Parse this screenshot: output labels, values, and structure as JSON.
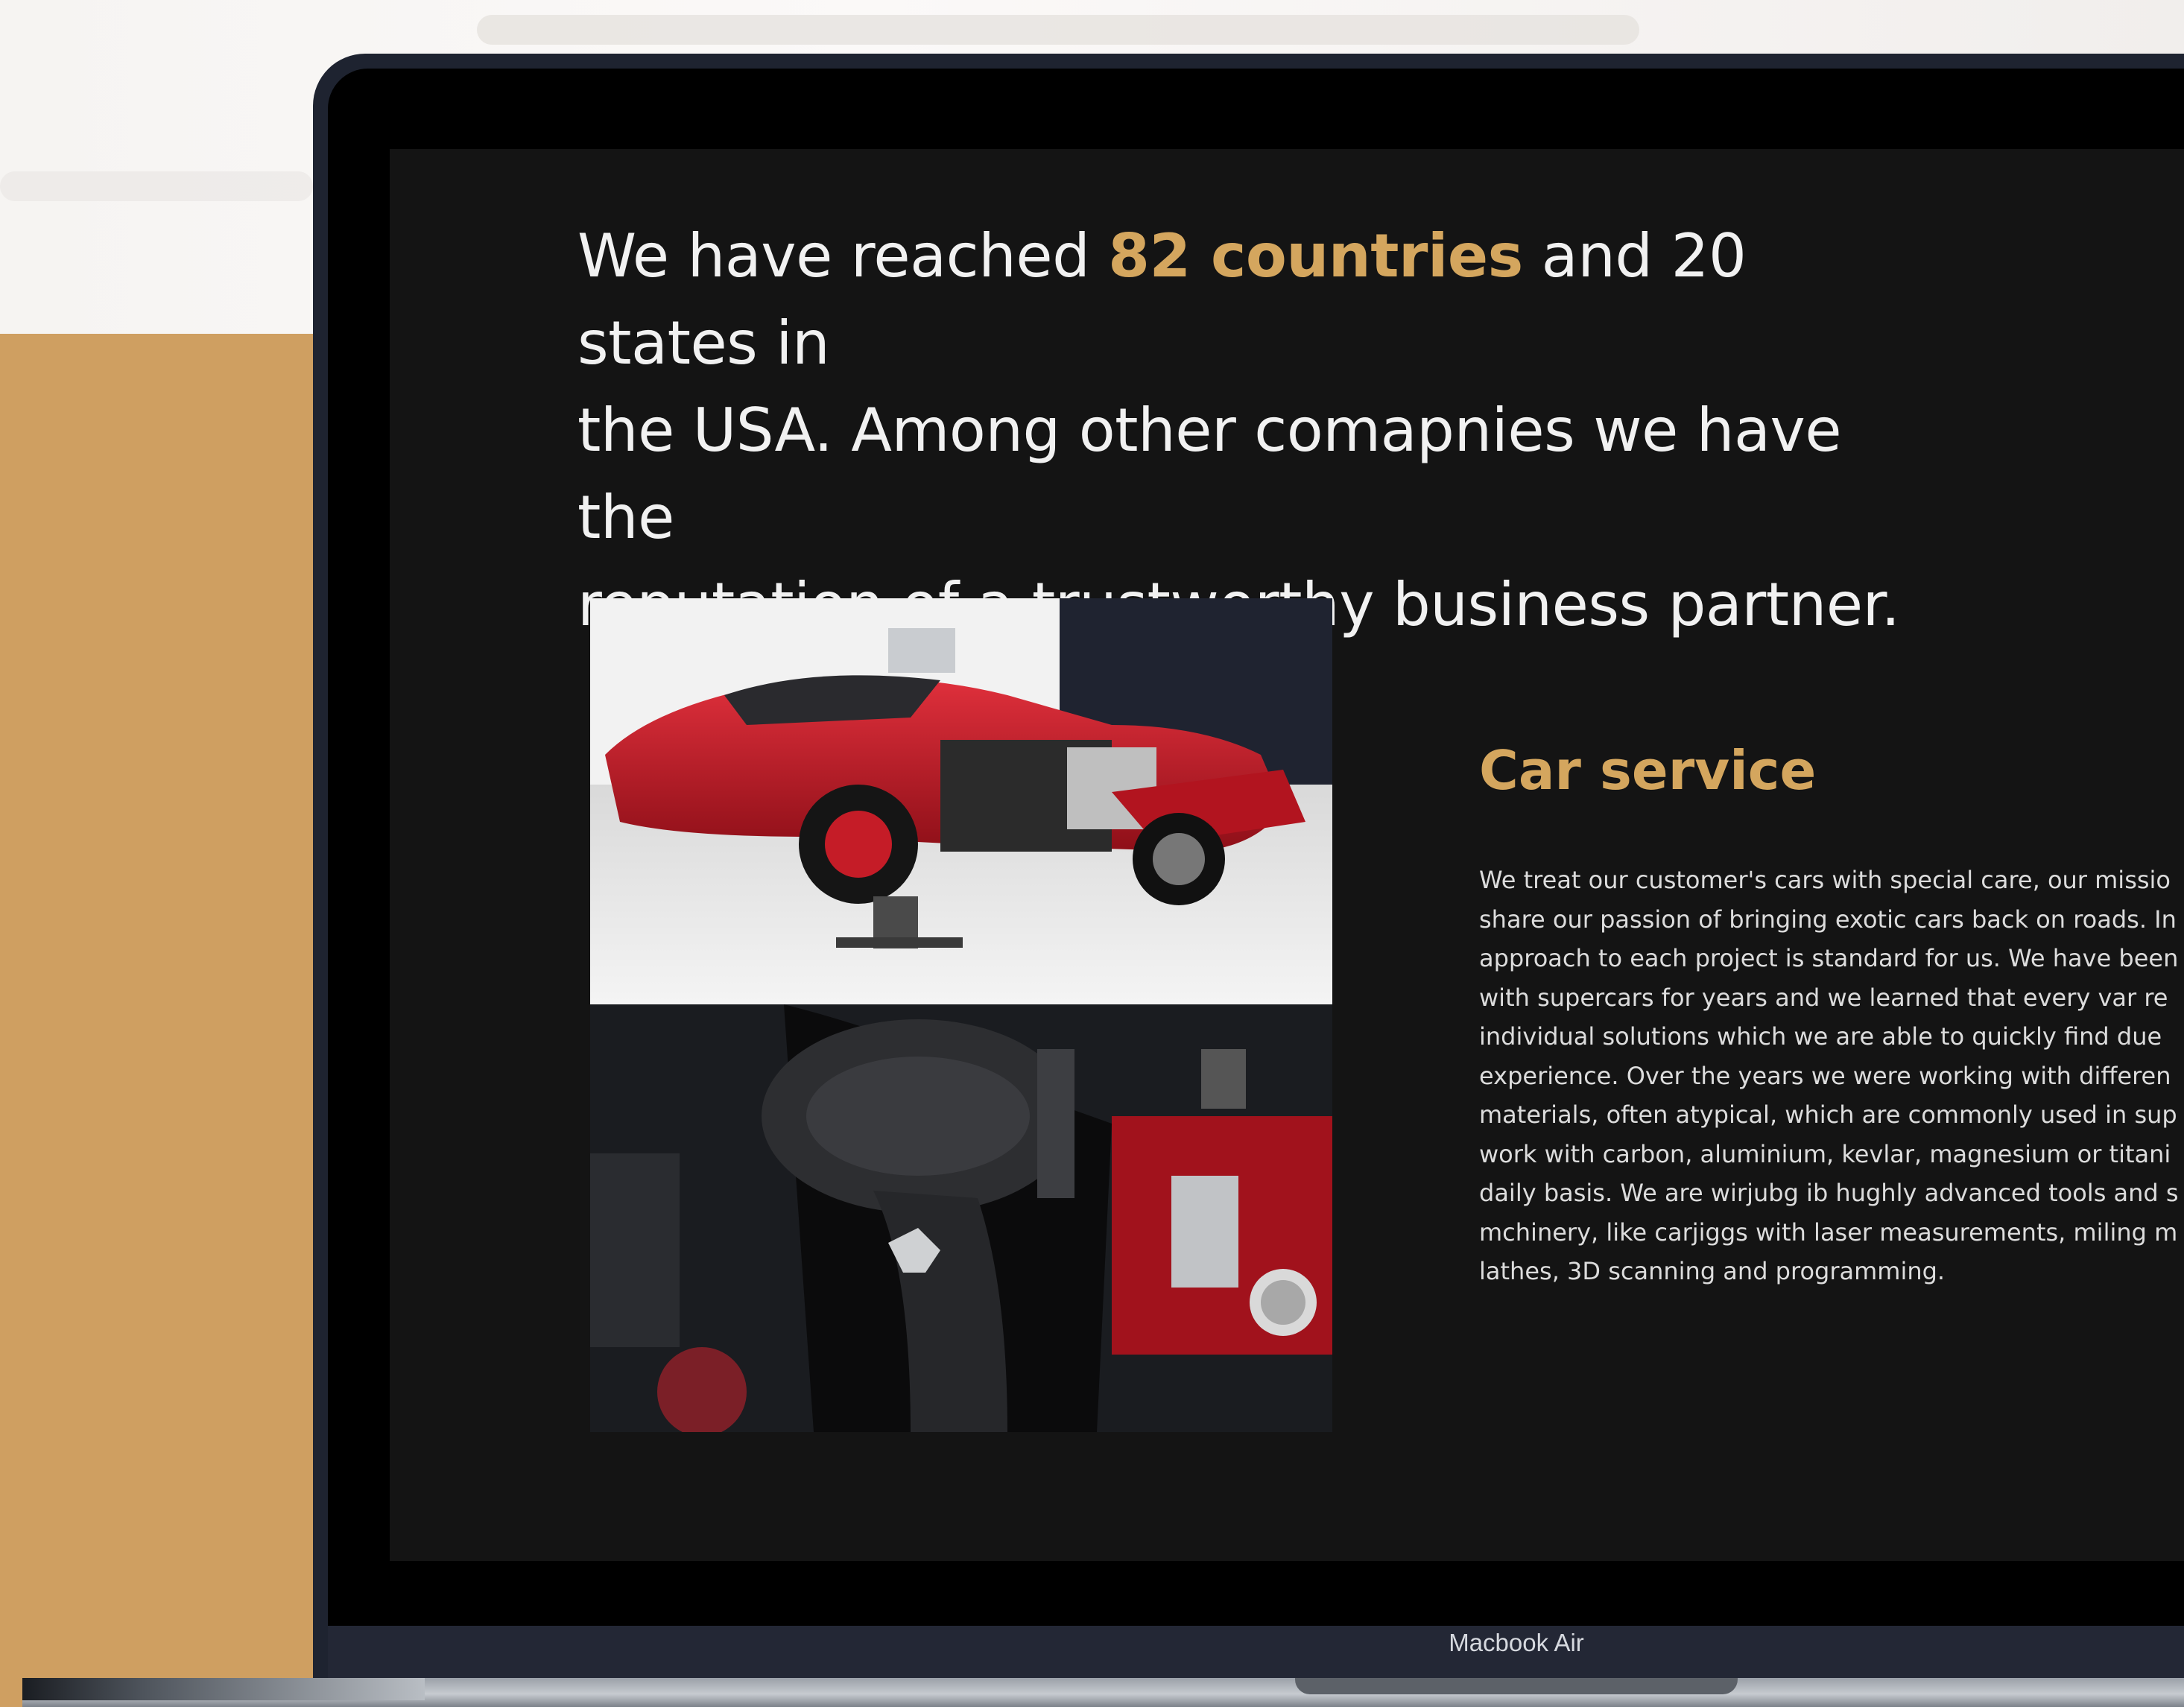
{
  "hero": {
    "text_before": "We have reached ",
    "highlight": "82 countries",
    "text_line1_end": " and 20 states in",
    "line2": "the USA. Among other comapnies we have the",
    "line3": "reputation of a trustworthy business partner."
  },
  "service": {
    "title": "Car service",
    "lines": [
      "We treat our customer's cars with special care, our missio",
      "share our passion of bringing exotic cars back on roads. In",
      "approach to each project is standard for us. We have been",
      "with supercars for years and we learned that every var re",
      "individual solutions which we are able to quickly find due",
      "experience. Over the years we were working with differen",
      "materials, often atypical, which are commonly used in sup",
      "work with carbon, aluminium, kevlar, magnesium or titani",
      "daily basis. We are wirjubg ib hughly advanced tools and s",
      "mchinery, like carjiggs with laser measurements, miling m",
      "lathes, 3D scanning and programming."
    ]
  },
  "images": {
    "top": "red-supercar-disassembled-photo",
    "bottom": "engine-bay-photo"
  },
  "device": {
    "label": "Macbook Air"
  },
  "colors": {
    "accent_gold": "#d4a65e",
    "panel_gold": "#cf9f61",
    "screen_bg": "#141414",
    "device_frame": "#1e2330"
  }
}
